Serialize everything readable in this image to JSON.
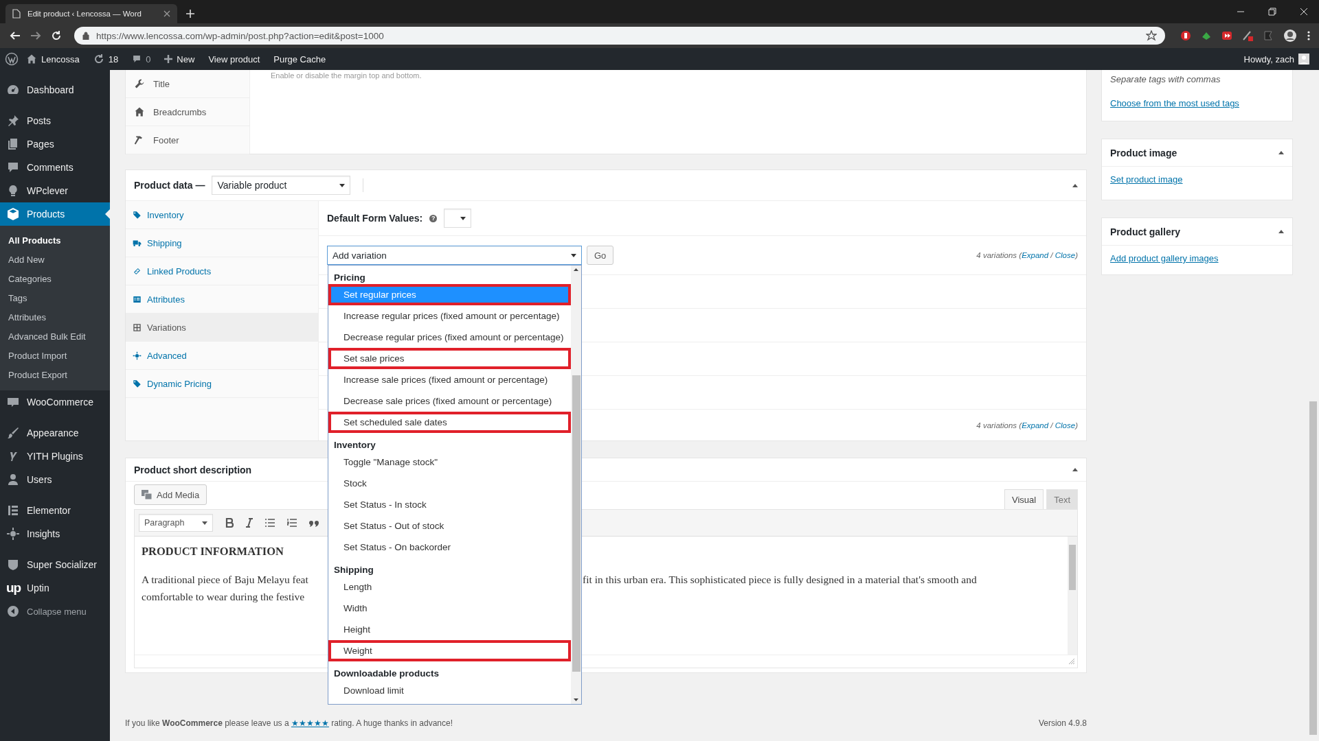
{
  "browser": {
    "tab_title": "Edit product ‹ Lencossa — Word",
    "url": "https://www.lencossa.com/wp-admin/post.php?action=edit&post=1000"
  },
  "admin_bar": {
    "site": "Lencossa",
    "updates": "18",
    "comments": "0",
    "new": "New",
    "links": [
      "View product",
      "Purge Cache"
    ],
    "greeting": "Howdy, zach"
  },
  "sidebar": {
    "sections": [
      {
        "items": [
          {
            "label": "Dashboard",
            "selected": false
          }
        ]
      },
      {
        "items": [
          {
            "label": "Posts",
            "selected": false
          },
          {
            "label": "Pages",
            "selected": false
          },
          {
            "label": "Comments",
            "selected": false
          },
          {
            "label": "WPclever",
            "selected": false
          },
          {
            "label": "Products",
            "selected": true,
            "children": [
              {
                "label": "All Products",
                "selected": true
              },
              {
                "label": "Add New",
                "selected": false
              },
              {
                "label": "Categories",
                "selected": false
              },
              {
                "label": "Tags",
                "selected": false
              },
              {
                "label": "Attributes",
                "selected": false
              },
              {
                "label": "Advanced Bulk Edit",
                "selected": false
              },
              {
                "label": "Product Import",
                "selected": false
              },
              {
                "label": "Product Export",
                "selected": false
              }
            ]
          },
          {
            "label": "WooCommerce",
            "selected": false
          }
        ]
      },
      {
        "items": [
          {
            "label": "Appearance",
            "selected": false
          },
          {
            "label": "YITH Plugins",
            "selected": false
          },
          {
            "label": "Users",
            "selected": false
          }
        ]
      },
      {
        "items": [
          {
            "label": "Elementor",
            "selected": false
          },
          {
            "label": "Insights",
            "selected": false
          }
        ]
      },
      {
        "items": [
          {
            "label": "Super Socializer",
            "selected": false
          },
          {
            "label": "Uptin",
            "selected": false,
            "logo_text": "up"
          }
        ]
      }
    ],
    "collapse": "Collapse menu"
  },
  "layout_box": {
    "hint": "Enable or disable the margin top and bottom.",
    "tabs": [
      "Title",
      "Breadcrumbs",
      "Footer"
    ]
  },
  "product_data": {
    "title": "Product data —",
    "type": "Variable product",
    "tabs": [
      {
        "label": "Inventory",
        "selected": false
      },
      {
        "label": "Shipping",
        "selected": false
      },
      {
        "label": "Linked Products",
        "selected": false
      },
      {
        "label": "Attributes",
        "selected": false
      },
      {
        "label": "Variations",
        "selected": true
      },
      {
        "label": "Advanced",
        "selected": false
      },
      {
        "label": "Dynamic Pricing",
        "selected": false
      }
    ],
    "default_label": "Default Form Values:",
    "help": "?",
    "bulk_action": "Add variation",
    "go": "Go",
    "count_top": [
      {
        "kind": "text",
        "text": "4 variations ("
      },
      {
        "kind": "link",
        "text": "Expand"
      },
      {
        "kind": "text",
        "text": " / "
      },
      {
        "kind": "link",
        "text": "Close"
      },
      {
        "kind": "text",
        "text": ")"
      }
    ],
    "count_bottom": [
      {
        "kind": "text",
        "text": "4 variations ("
      },
      {
        "kind": "link",
        "text": "Expand"
      },
      {
        "kind": "text",
        "text": " / "
      },
      {
        "kind": "link",
        "text": "Close"
      },
      {
        "kind": "text",
        "text": ")"
      }
    ],
    "dropdown": [
      {
        "label": "Pricing",
        "options": [
          {
            "label": "Set regular prices",
            "selected": true,
            "marked": true
          },
          {
            "label": "Increase regular prices (fixed amount or percentage)",
            "selected": false,
            "marked": false
          },
          {
            "label": "Decrease regular prices (fixed amount or percentage)",
            "selected": false,
            "marked": false
          },
          {
            "label": "Set sale prices",
            "selected": false,
            "marked": true
          },
          {
            "label": "Increase sale prices (fixed amount or percentage)",
            "selected": false,
            "marked": false
          },
          {
            "label": "Decrease sale prices (fixed amount or percentage)",
            "selected": false,
            "marked": false
          },
          {
            "label": "Set scheduled sale dates",
            "selected": false,
            "marked": true
          }
        ]
      },
      {
        "label": "Inventory",
        "options": [
          {
            "label": "Toggle \"Manage stock\"",
            "selected": false,
            "marked": false
          },
          {
            "label": "Stock",
            "selected": false,
            "marked": false
          },
          {
            "label": "Set Status - In stock",
            "selected": false,
            "marked": false
          },
          {
            "label": "Set Status - Out of stock",
            "selected": false,
            "marked": false
          },
          {
            "label": "Set Status - On backorder",
            "selected": false,
            "marked": false
          }
        ]
      },
      {
        "label": "Shipping",
        "options": [
          {
            "label": "Length",
            "selected": false,
            "marked": false
          },
          {
            "label": "Width",
            "selected": false,
            "marked": false
          },
          {
            "label": "Height",
            "selected": false,
            "marked": false
          },
          {
            "label": "Weight",
            "selected": false,
            "marked": true
          }
        ]
      },
      {
        "label": "Downloadable products",
        "options": [
          {
            "label": "Download limit",
            "selected": false,
            "marked": false
          }
        ]
      }
    ]
  },
  "short_description": {
    "title": "Product short description",
    "add_media": "Add Media",
    "format": "Paragraph",
    "tabs": [
      {
        "label": "Visual",
        "selected": true
      },
      {
        "label": "Text",
        "selected": false
      }
    ],
    "heading": "PRODUCT INFORMATION",
    "left_lines": [
      "A traditional piece of Baju Melayu feat",
      "comfortable to wear during the festive"
    ],
    "right_lines": [
      "fit in this urban era. This sophisticated piece is fully designed in a material that's smooth and"
    ]
  },
  "tags_box": {
    "hint": "Separate tags with commas",
    "link": "Choose from the most used tags"
  },
  "image_box": {
    "title": "Product image",
    "link": "Set product image"
  },
  "gallery_box": {
    "title": "Product gallery",
    "link": "Add product gallery images"
  },
  "footer": {
    "before": "If you like **WooCommerce** please leave us a ",
    "stars": "★★★★★",
    "after": " rating. A huge thanks in advance!",
    "version": "Version 4.9.8"
  }
}
